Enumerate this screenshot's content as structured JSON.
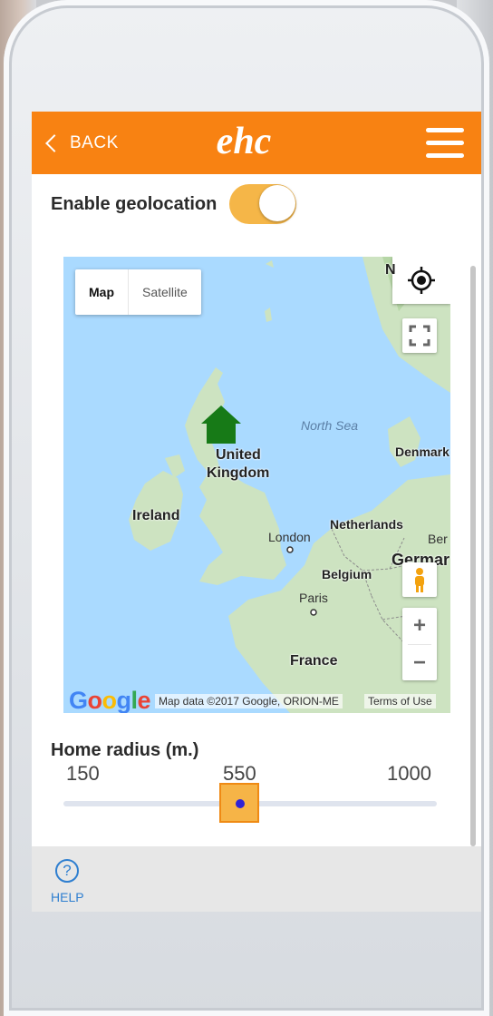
{
  "app": {
    "back_label": "BACK",
    "logo_text": "ehc",
    "brand_color": "#f88212",
    "accent_color": "#f6b447"
  },
  "geolocation": {
    "label": "Enable geolocation",
    "enabled": true
  },
  "map": {
    "type_options": [
      "Map",
      "Satellite"
    ],
    "selected_type": "Map",
    "labels": {
      "north_sea": "North Sea",
      "united": "United",
      "kingdom": "Kingdom",
      "ireland": "Ireland",
      "london": "London",
      "netherlands": "Netherlands",
      "belgium": "Belgium",
      "paris": "Paris",
      "france": "France",
      "denmark": "Denmark",
      "germany": "Germar",
      "berlin": "Ber",
      "n_partial": "N"
    },
    "zoom_in": "+",
    "zoom_out": "−",
    "google": "Google",
    "attribution": "Map data ©2017 Google, ORION-ME",
    "terms": "Terms of Use",
    "icons": [
      "my-location-icon",
      "fullscreen-icon",
      "pegman-icon",
      "home-marker-icon"
    ]
  },
  "radius": {
    "title": "Home radius (m.)",
    "min_label": "150",
    "current_label": "550",
    "max_label": "1000",
    "min": 150,
    "max": 1000,
    "value": 550
  },
  "footer": {
    "help_label": "HELP",
    "help_icon": "?"
  }
}
